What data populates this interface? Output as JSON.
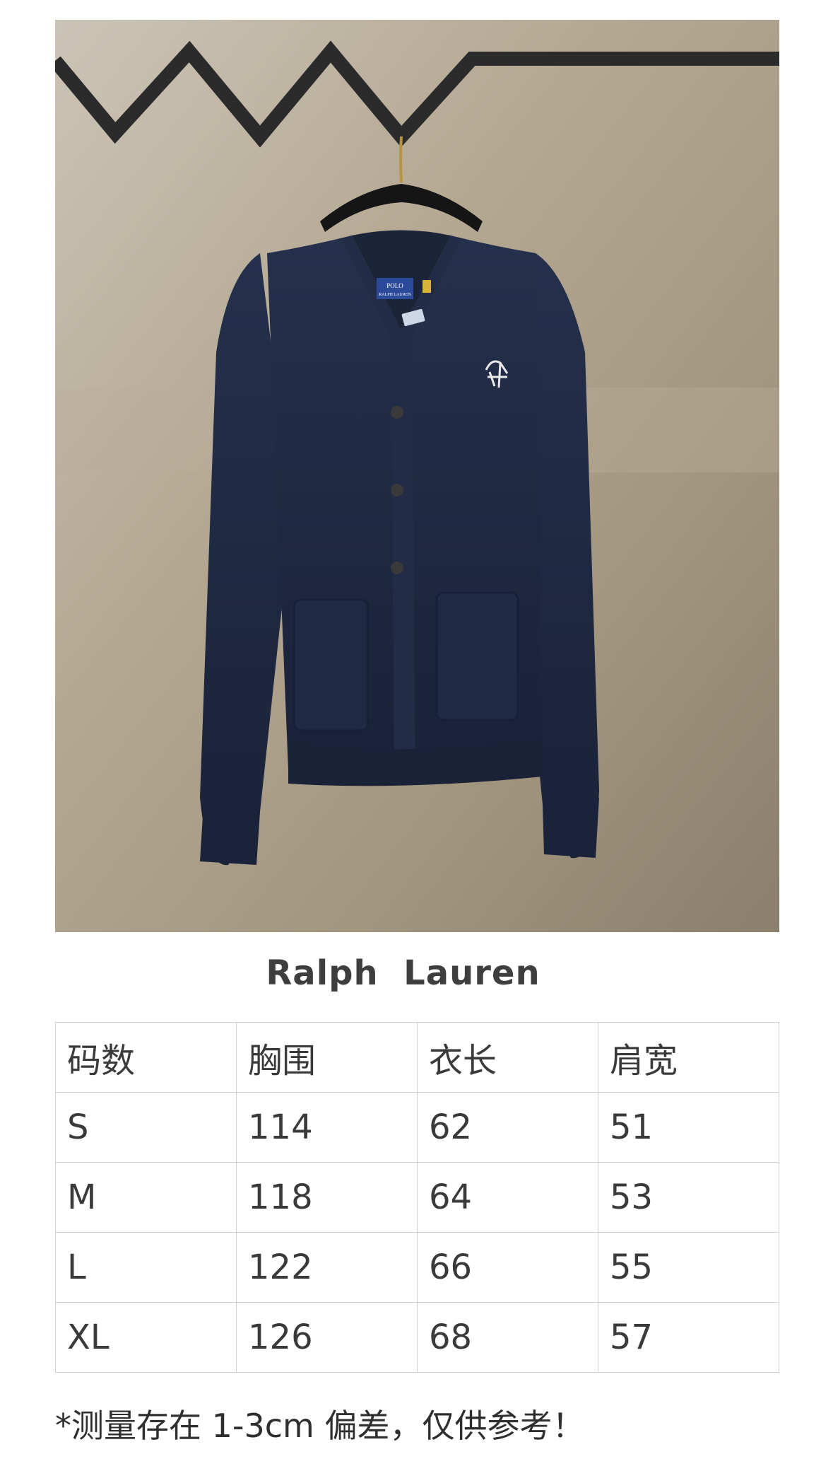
{
  "product": {
    "brand_title": "Ralph  Lauren",
    "photo": {
      "subject": "navy-v-neck-cardigan",
      "tag_text_line1": "POLO",
      "tag_text_line2": "RALPH LAUREN",
      "colors": {
        "garment": "#1f2a44",
        "background": "#b3a895",
        "hanger_rail": "#2a2a2a"
      }
    }
  },
  "size_table": {
    "headers": [
      "码数",
      "胸围",
      "衣长",
      "肩宽"
    ],
    "rows": [
      [
        "S",
        "114",
        "62",
        "51"
      ],
      [
        "M",
        "118",
        "64",
        "53"
      ],
      [
        "L",
        "122",
        "66",
        "55"
      ],
      [
        "XL",
        "126",
        "68",
        "57"
      ]
    ]
  },
  "note": "*测量存在 1-3cm 偏差，仅供参考！"
}
